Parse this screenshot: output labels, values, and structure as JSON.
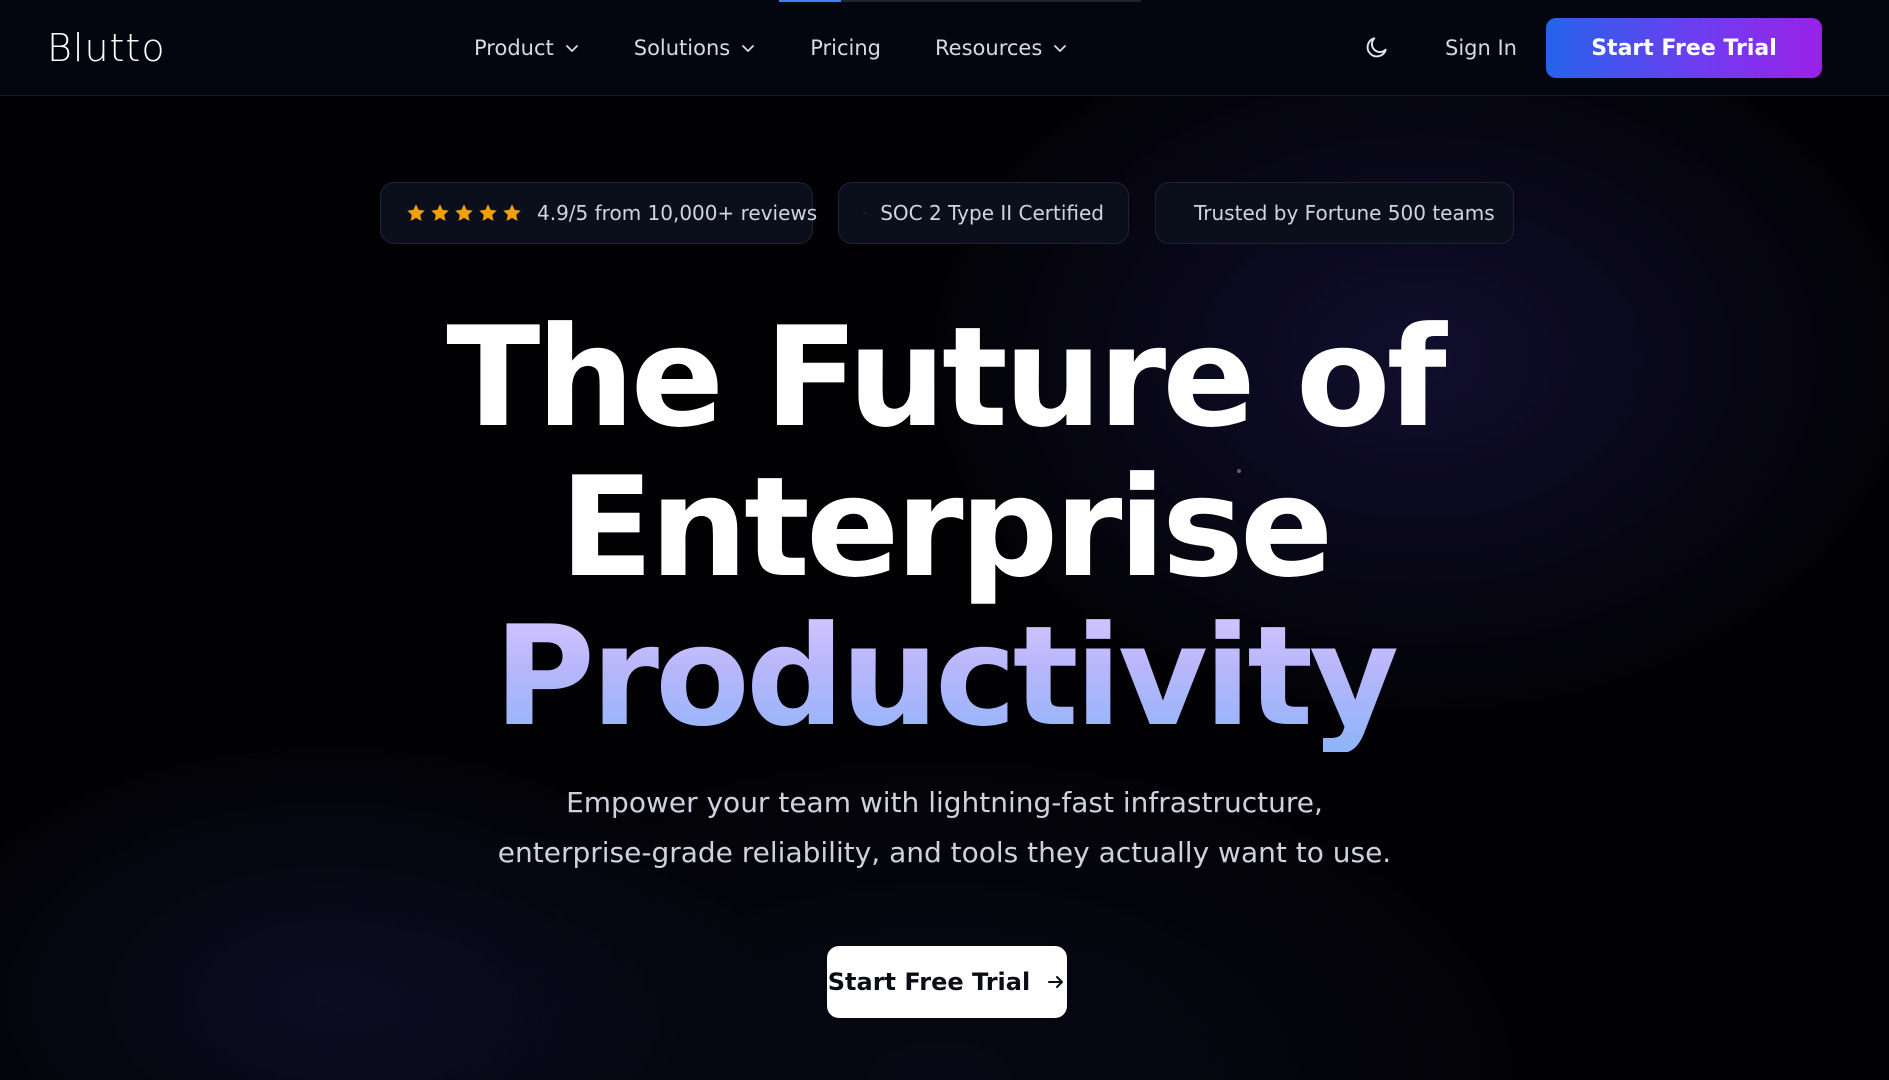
{
  "brand": {
    "name": "Blutto",
    "accent": "#3b82f6",
    "cta_gradient": [
      "#2563eb",
      "#9b22e8"
    ],
    "star_color": "#f59e0b",
    "check_color": "#22c55e",
    "sparkle_color": "#60a5fa"
  },
  "nav": {
    "scroll_progress": 0.17,
    "links": [
      {
        "label": "Product",
        "has_dropdown": true
      },
      {
        "label": "Solutions",
        "has_dropdown": true
      },
      {
        "label": "Pricing",
        "has_dropdown": false
      },
      {
        "label": "Resources",
        "has_dropdown": true
      }
    ],
    "theme_icon": "moon-icon",
    "sign_in": "Sign In",
    "cta": "Start Free Trial"
  },
  "badges": {
    "rating": {
      "stars": 5,
      "text": "4.9/5 from 10,000+ reviews"
    },
    "soc": {
      "icon": "check-icon",
      "text": "SOC 2 Type II Certified"
    },
    "trust": {
      "icon": "sparkle-icon",
      "text": "Trusted by Fortune 500 teams"
    }
  },
  "hero": {
    "line1": "The Future of",
    "line2": "Enterprise",
    "line3": "Productivity",
    "subtitle_line1": "Empower your team with lightning-fast infrastructure,",
    "subtitle_line2": "enterprise-grade reliability, and tools they actually want to use.",
    "cta": "Start Free Trial",
    "cta_icon": "arrow-right-icon"
  }
}
